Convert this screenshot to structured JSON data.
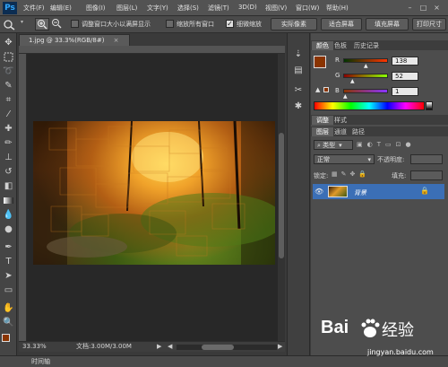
{
  "app": {
    "logo": "Ps"
  },
  "menu": [
    "文件(F)",
    "编辑(E)",
    "图像(I)",
    "图层(L)",
    "文字(Y)",
    "选择(S)",
    "滤镜(T)",
    "3D(D)",
    "视图(V)",
    "窗口(W)",
    "帮助(H)"
  ],
  "window_controls": [
    "–",
    "□",
    "×"
  ],
  "options_bar": {
    "checkboxes": [
      {
        "label": "调整窗口大小以满屏显示",
        "checked": false
      },
      {
        "label": "缩放所有窗口",
        "checked": false
      },
      {
        "label": "细微缩放",
        "checked": true
      }
    ],
    "buttons": [
      "实际像素",
      "适合屏幕",
      "填充屏幕",
      "打印尺寸"
    ]
  },
  "document": {
    "tab_title": "1.jpg @ 33.3%(RGB/8#)",
    "tab_close": "×",
    "zoom": "33.33%",
    "doc_size": "文档:3.00M/3.00M"
  },
  "timeline": {
    "label": "时间轴"
  },
  "color_panel": {
    "tabs": [
      "颜色",
      "色板",
      "历史记录"
    ],
    "channels": [
      {
        "label": "R",
        "value": "138"
      },
      {
        "label": "G",
        "value": "52"
      },
      {
        "label": "B",
        "value": "1"
      }
    ],
    "foreground_color": "#8a3401"
  },
  "adjust_panel": {
    "tabs": [
      "调整",
      "样式"
    ]
  },
  "layers_panel": {
    "tabs": [
      "图层",
      "通道",
      "路径"
    ],
    "filter_kind": "类型",
    "blend_mode": "正常",
    "opacity_label": "不透明度:",
    "lock_label": "锁定:",
    "fill_label": "填充:",
    "layers": [
      {
        "name": "背景",
        "visible": true,
        "locked": true
      }
    ]
  },
  "watermark": {
    "brand": "Bai",
    "brand2": "经验",
    "url": "jingyan.baidu.com"
  }
}
